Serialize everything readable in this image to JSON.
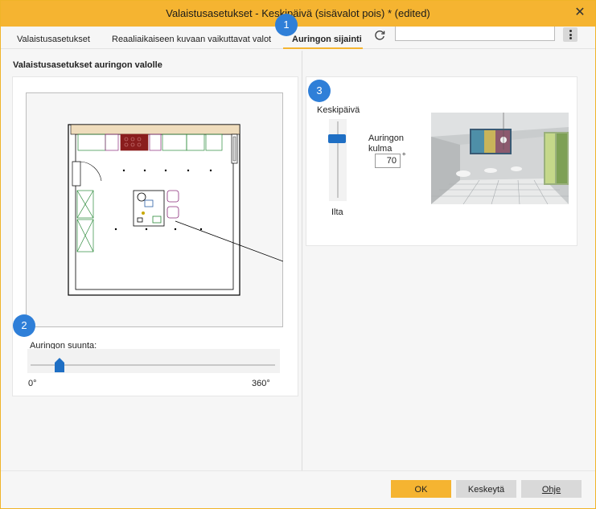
{
  "window": {
    "title": "Valaistusasetukset - Keskipäivä (sisävalot pois) * (edited)",
    "close_symbol": "✕"
  },
  "tabs": [
    {
      "label": "Valaistusasetukset",
      "active": false
    },
    {
      "label": "Reaaliaikaiseen kuvaan vaikuttavat valot",
      "active": false
    },
    {
      "label": "Auringon sijainti",
      "active": true
    }
  ],
  "toolbar": {
    "refresh_icon": "refresh-icon",
    "search_value": "",
    "more_icon": "kebab-menu-icon"
  },
  "left_panel": {
    "title": "Valaistusasetukset auringon valolle",
    "direction_label": "Auringon suunta:",
    "direction_min": "0°",
    "direction_max": "360°",
    "direction_value_fraction": 0.12
  },
  "right_panel": {
    "elevation_top_label": "Keskipäivä",
    "elevation_bottom_label": "Ilta",
    "elevation_value_fraction": 0.22,
    "angle_label": "Auringon kulma",
    "angle_value": "70",
    "angle_unit": "°"
  },
  "badges": [
    "1",
    "2",
    "3"
  ],
  "buttons": {
    "ok": "OK",
    "cancel": "Keskeytä",
    "help": "Ohje"
  },
  "colors": {
    "accent": "#f5b431",
    "badge": "#2f7fd8",
    "slider_thumb": "#1f6fc4"
  }
}
